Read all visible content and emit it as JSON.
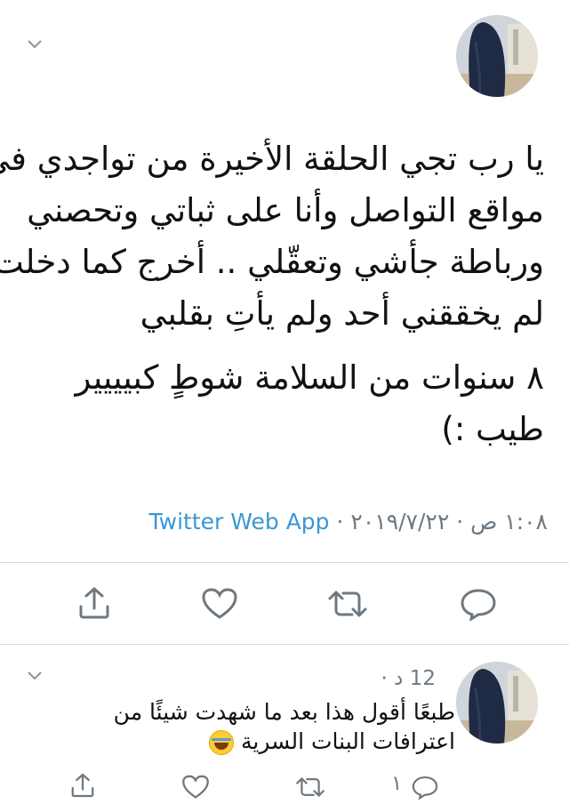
{
  "tweet": {
    "lines": [
      "يا رب تجي الحلقة الأخيرة من تواجدي في",
      "مواقع التواصل وأنا على ثباتي وتحصني",
      "ورباطة جأشي وتعقّلي .. أخرج كما دخلت",
      "لم يخققني أحد ولم يأتِ بقلبي",
      "٨ سنوات من السلامة شوطٍ كبيييير",
      "طيب :)"
    ],
    "time": "١:٠٨ ص",
    "date": "٢٠١٩/٧/٢٢",
    "source": "Twitter Web App",
    "separator": "·"
  },
  "reply": {
    "age": "12 د",
    "separator": "·",
    "lines": [
      "طبعًا أقول هذا بعد ما شهدت شيئًا من",
      "اعترافات البنات السرية"
    ],
    "like_count": "١"
  },
  "icons": {
    "menu": "chevron-down-icon",
    "reply": "speech-bubble-icon",
    "retweet": "retweet-icon",
    "like": "heart-icon",
    "share": "share-upload-icon",
    "emoji": "face-with-tears-of-joy-emoji"
  },
  "colors": {
    "link": "#3b97d3",
    "icon": "#6e7880",
    "divider": "#d6d9dc"
  }
}
